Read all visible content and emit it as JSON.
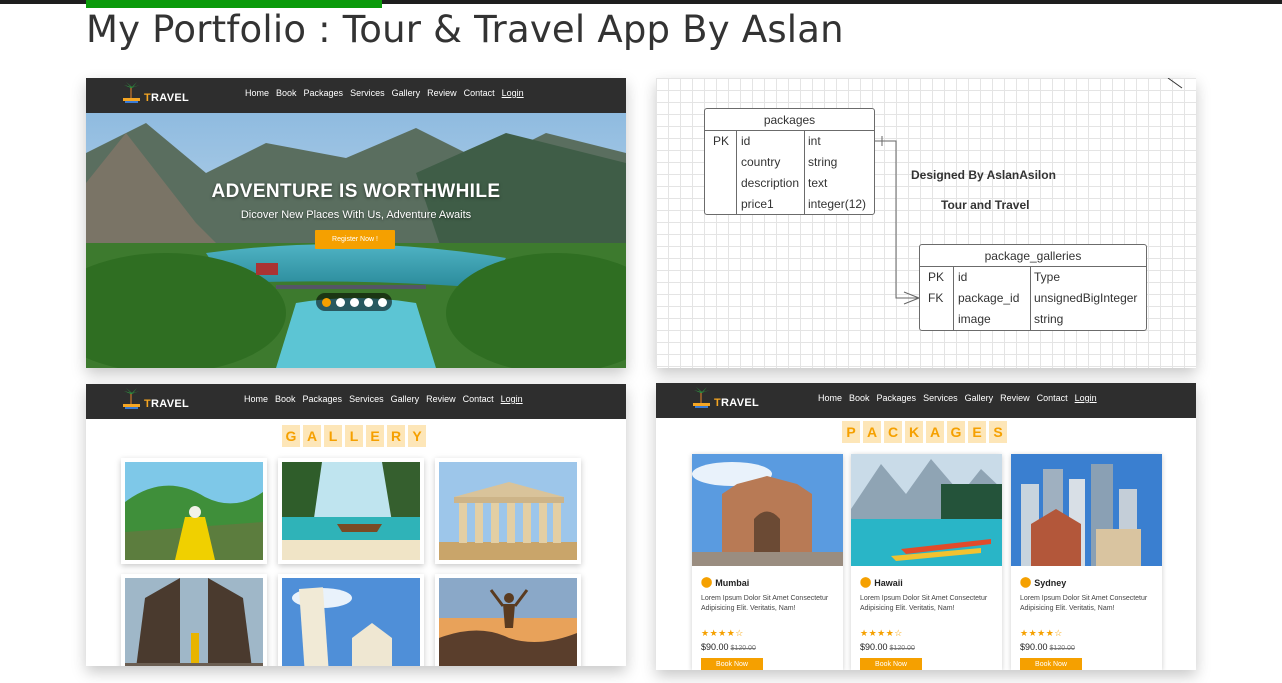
{
  "page": {
    "title": "My Portfolio : Tour & Travel App By Aslan"
  },
  "nav": {
    "brand": "TRAVEL",
    "links": [
      "Home",
      "Book",
      "Packages",
      "Services",
      "Gallery",
      "Review",
      "Contact"
    ],
    "login": "Login"
  },
  "hero": {
    "title": "ADVENTURE IS WORTHWHILE",
    "subtitle": "Dicover New Places With Us, Adventure Awaits",
    "button": "Register Now !",
    "slides": 5,
    "active_slide": 1
  },
  "diagram": {
    "packages": {
      "title": "packages",
      "keys": [
        "PK",
        "",
        "",
        ""
      ],
      "fields": [
        "id",
        "country",
        "description",
        "price1"
      ],
      "types": [
        "int",
        "string",
        "text",
        "integer(12)"
      ]
    },
    "galleries": {
      "title": "package_galleries",
      "keys": [
        "PK",
        "FK",
        ""
      ],
      "fields": [
        "id",
        "package_id",
        "image"
      ],
      "types": [
        "Type",
        "unsignedBigInteger",
        "string"
      ]
    },
    "designed_by": "Designed By AslanAsilon",
    "subtitle": "Tour and Travel"
  },
  "gallery": {
    "heading": [
      "G",
      "A",
      "L",
      "L",
      "E",
      "R",
      "Y"
    ],
    "items": [
      "island-photo",
      "boat-beach-photo",
      "parthenon-photo",
      "temple-gate-photo",
      "pisa-tower-photo",
      "sunset-hiker-photo"
    ]
  },
  "packages": {
    "heading": [
      "P",
      "A",
      "C",
      "K",
      "A",
      "G",
      "E",
      "S"
    ],
    "items": [
      {
        "name": "Mumbai",
        "desc": "Lorem Ipsum Dolor Sit Amet Consectetur Adipisicing Elit. Veritatis, Nam!",
        "stars": "★★★★☆",
        "price": "$90.00",
        "old_price": "$120.00",
        "button": "Book Now"
      },
      {
        "name": "Hawaii",
        "desc": "Lorem Ipsum Dolor Sit Amet Consectetur Adipisicing Elit. Veritatis, Nam!",
        "stars": "★★★★☆",
        "price": "$90.00",
        "old_price": "$120.00",
        "button": "Book Now"
      },
      {
        "name": "Sydney",
        "desc": "Lorem Ipsum Dolor Sit Amet Consectetur Adipisicing Elit. Veritatis, Nam!",
        "stars": "★★★★☆",
        "price": "$90.00",
        "old_price": "$120.00",
        "button": "Book Now"
      }
    ]
  },
  "colors": {
    "accent": "#f5a000",
    "nav_bg": "#2e2e2e",
    "progress": "#0a9a0a"
  }
}
